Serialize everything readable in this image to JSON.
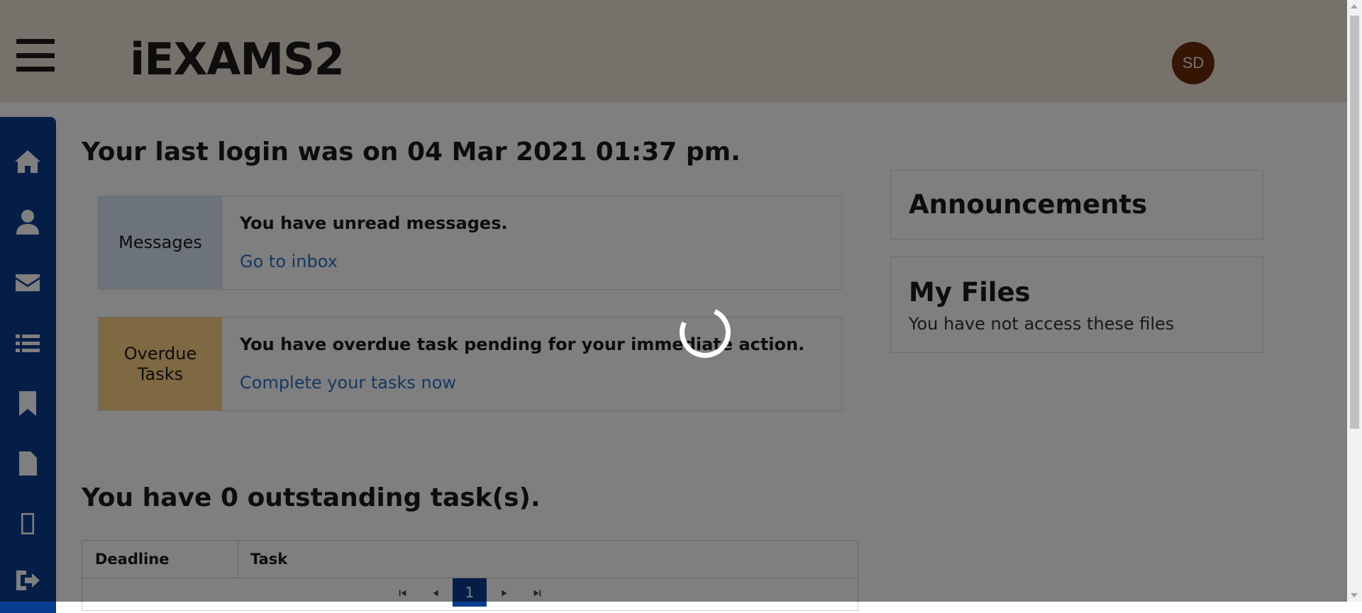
{
  "header": {
    "app_title": "iEXAMS2",
    "user_initials": "SD"
  },
  "sidebar": {
    "items": [
      {
        "icon": "home-icon"
      },
      {
        "icon": "user-icon"
      },
      {
        "icon": "envelope-icon"
      },
      {
        "icon": "list-icon"
      },
      {
        "icon": "bookmark-icon"
      },
      {
        "icon": "file-icon"
      },
      {
        "icon": "tablet-icon"
      },
      {
        "icon": "sign-out-icon"
      }
    ]
  },
  "main": {
    "last_login": "Your last login was on 04 Mar 2021 01:37 pm.",
    "messages_card": {
      "label": "Messages",
      "text": "You have unread messages.",
      "link": "Go to inbox",
      "color": "#dbe6f5"
    },
    "overdue_card": {
      "label_line1": "Overdue",
      "label_line2": "Tasks",
      "text": "You have overdue task pending for your immediate action.",
      "link": "Complete your tasks now",
      "color": "#ffd286"
    },
    "outstanding_title": "You have 0 outstanding task(s).",
    "table": {
      "columns": [
        "Deadline",
        "Task"
      ],
      "current_page": "1"
    }
  },
  "right_panel": {
    "announcements_title": "Announcements",
    "my_files_title": "My Files",
    "my_files_text": "You have not access these files"
  },
  "colors": {
    "sidebar": "#0a3d8f",
    "header": "#ece3d5",
    "link": "#2a72c9",
    "avatar": "#6b2d0b"
  }
}
